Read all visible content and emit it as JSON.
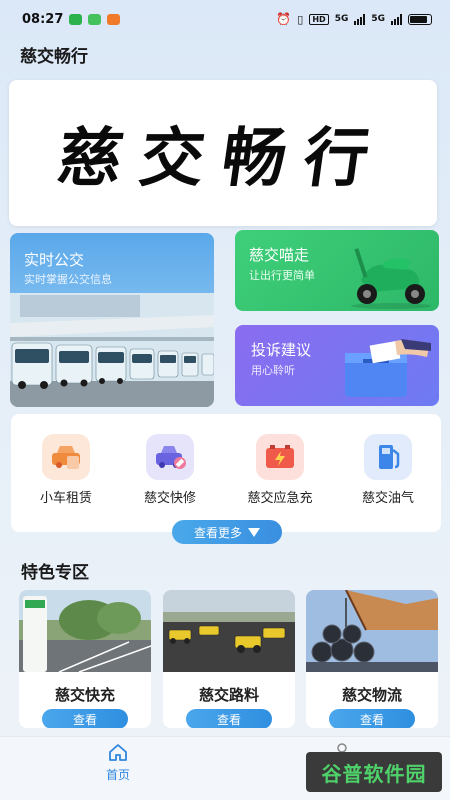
{
  "status_bar": {
    "time": "08:27",
    "hd": "HD",
    "net1": "5G",
    "net2": "5G"
  },
  "app": {
    "title": "慈交畅行"
  },
  "banner": {
    "text": "慈交畅行"
  },
  "cards": {
    "bus": {
      "title": "实时公交",
      "subtitle": "实时掌握公交信息"
    },
    "walk": {
      "title": "慈交喵走",
      "subtitle": "让出行更简单"
    },
    "complaint": {
      "title": "投诉建议",
      "subtitle": "用心聆听"
    }
  },
  "services": [
    {
      "label": "小车租赁",
      "icon": "car-rental-icon",
      "color": "#f08a3c"
    },
    {
      "label": "慈交快修",
      "icon": "car-repair-icon",
      "color": "#6a63e0"
    },
    {
      "label": "慈交应急充",
      "icon": "battery-charge-icon",
      "color": "#ef5a4a"
    },
    {
      "label": "慈交油气",
      "icon": "fuel-pump-icon",
      "color": "#3b86e8"
    }
  ],
  "more_button": {
    "label": "查看更多"
  },
  "section": {
    "title": "特色专区"
  },
  "specials": [
    {
      "name": "慈交快充",
      "button": "查看"
    },
    {
      "name": "慈交路料",
      "button": "查看"
    },
    {
      "name": "慈交物流",
      "button": "查看"
    }
  ],
  "nav": {
    "home_label": "首页"
  },
  "watermark": {
    "text": "谷普软件园"
  },
  "colors": {
    "accent": "#2f87e0",
    "walk_green": "#35c472",
    "complaint_purple": "#7b73f0"
  }
}
